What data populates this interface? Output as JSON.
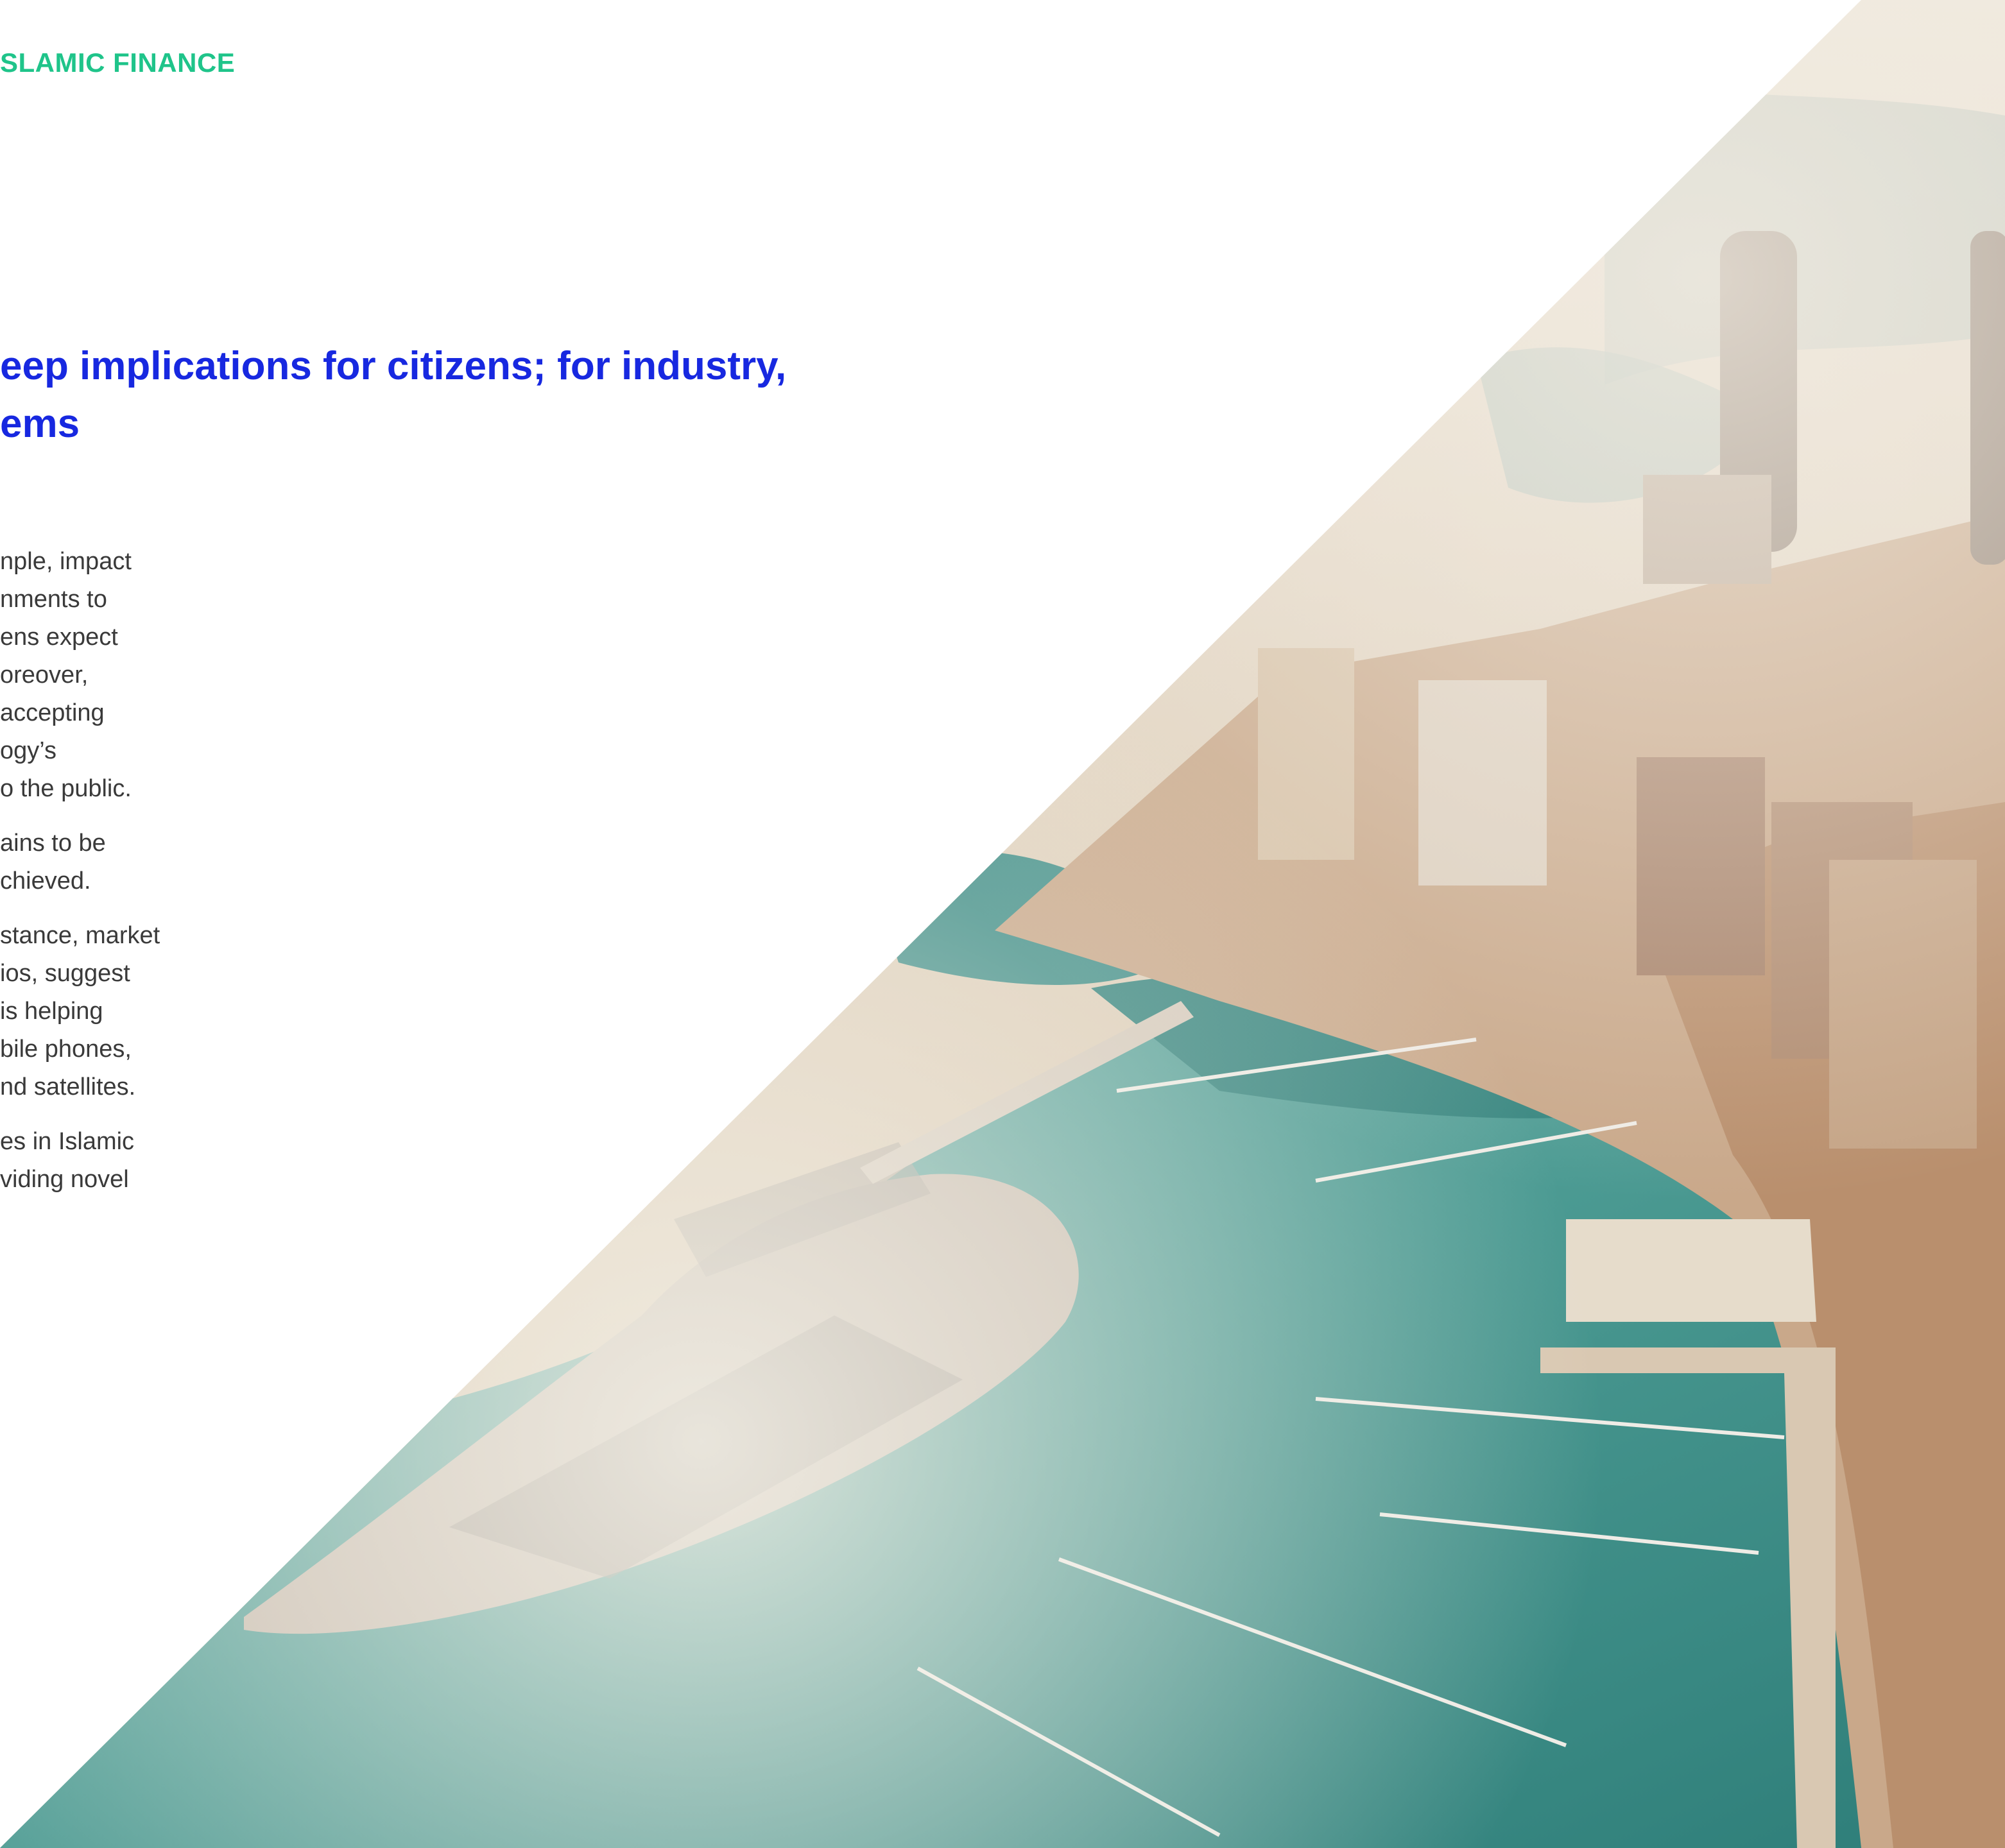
{
  "header": {
    "section_label": "SLAMIC FINANCE"
  },
  "headline": {
    "lines": [
      "eep implications for citizens; for industry,",
      "ems"
    ]
  },
  "body": {
    "paragraphs": [
      {
        "lines": [
          "nple, impact",
          "nments to",
          "ens expect",
          "oreover,",
          "accepting",
          "ogy’s",
          "o the public."
        ]
      },
      {
        "lines": [
          "ains to be",
          "chieved."
        ]
      },
      {
        "lines": [
          "stance, market",
          "ios, suggest",
          "is helping",
          "bile phones,",
          "nd satellites."
        ]
      },
      {
        "lines": [
          "es in Islamic",
          "viding novel"
        ]
      }
    ]
  },
  "photo": {
    "subject": "aerial-marina-city",
    "colors": {
      "sky": "#e9e0d2",
      "water": "#4a9c95",
      "buildings": "#c9a88a",
      "sand": "#d8c6ae"
    }
  }
}
